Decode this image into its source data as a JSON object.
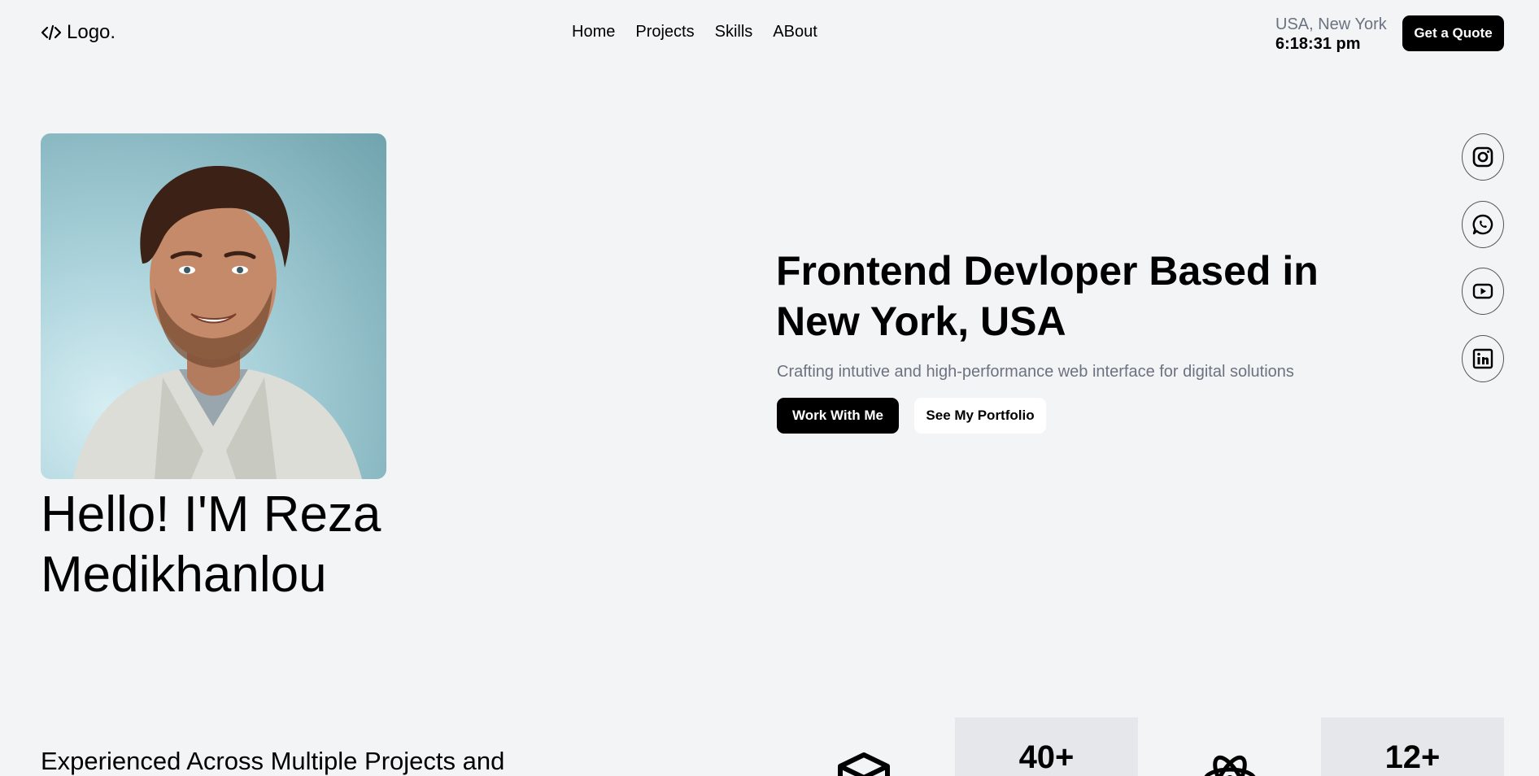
{
  "header": {
    "logo_text": "Logo.",
    "nav": [
      "Home",
      "Projects",
      "Skills",
      "ABout"
    ],
    "location": "USA, New York",
    "time": "6:18:31 pm",
    "quote_button": "Get a Quote"
  },
  "hero": {
    "greeting": "Hello! I'M Reza Medikhanlou",
    "title": "Frontend Devloper Based in New York, USA",
    "subtitle": "Crafting intutive and high-performance web interface for digital solutions",
    "primary_button": "Work With Me",
    "secondary_button": "See My Portfolio"
  },
  "social": [
    "instagram-icon",
    "whatsapp-icon",
    "youtube-icon",
    "linkedin-icon"
  ],
  "stats": {
    "headline": "Experienced Across Multiple Projects and",
    "items": [
      {
        "icon": "cube-icon",
        "value": "40+"
      },
      {
        "icon": "react-icon",
        "value": "12+"
      }
    ]
  },
  "colors": {
    "background": "#f3f4f6",
    "accent": "#000000",
    "muted": "#6b7280",
    "stat_box": "#e5e7eb"
  }
}
